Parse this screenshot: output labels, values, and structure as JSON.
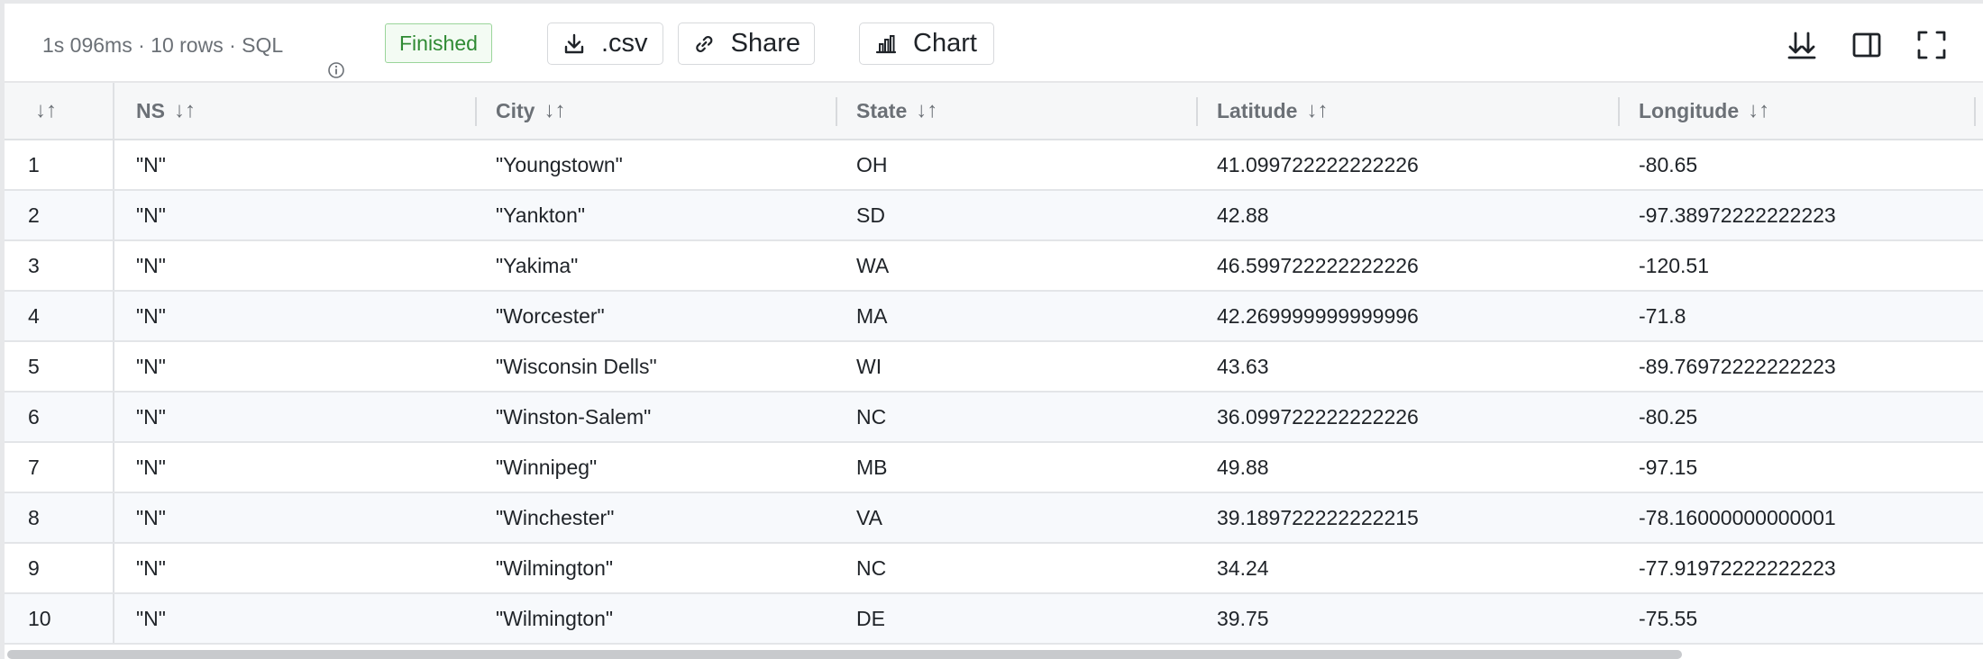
{
  "toolbar": {
    "duration": "1s 096ms",
    "sep": " · ",
    "rows": "10 rows",
    "lang": "SQL",
    "status": "Finished",
    "csv_label": ".csv",
    "share_label": "Share",
    "chart_label": "Chart"
  },
  "table": {
    "columns": [
      "NS",
      "City",
      "State",
      "Latitude",
      "Longitude"
    ],
    "rows": [
      {
        "idx": "1",
        "ns": "\"N\"",
        "city": "\"Youngstown\"",
        "state": "OH",
        "lat": "41.099722222222226",
        "lon": "-80.65"
      },
      {
        "idx": "2",
        "ns": "\"N\"",
        "city": "\"Yankton\"",
        "state": "SD",
        "lat": "42.88",
        "lon": "-97.38972222222223"
      },
      {
        "idx": "3",
        "ns": "\"N\"",
        "city": "\"Yakima\"",
        "state": "WA",
        "lat": "46.599722222222226",
        "lon": "-120.51"
      },
      {
        "idx": "4",
        "ns": "\"N\"",
        "city": "\"Worcester\"",
        "state": "MA",
        "lat": "42.269999999999996",
        "lon": "-71.8"
      },
      {
        "idx": "5",
        "ns": "\"N\"",
        "city": "\"Wisconsin Dells\"",
        "state": "WI",
        "lat": "43.63",
        "lon": "-89.76972222222223"
      },
      {
        "idx": "6",
        "ns": "\"N\"",
        "city": "\"Winston-Salem\"",
        "state": "NC",
        "lat": "36.099722222222226",
        "lon": "-80.25"
      },
      {
        "idx": "7",
        "ns": "\"N\"",
        "city": "\"Winnipeg\"",
        "state": "MB",
        "lat": "49.88",
        "lon": "-97.15"
      },
      {
        "idx": "8",
        "ns": "\"N\"",
        "city": "\"Winchester\"",
        "state": "VA",
        "lat": "39.189722222222215",
        "lon": "-78.16000000000001"
      },
      {
        "idx": "9",
        "ns": "\"N\"",
        "city": "\"Wilmington\"",
        "state": "NC",
        "lat": "34.24",
        "lon": "-77.91972222222223"
      },
      {
        "idx": "10",
        "ns": "\"N\"",
        "city": "\"Wilmington\"",
        "state": "DE",
        "lat": "39.75",
        "lon": "-75.55"
      }
    ]
  },
  "icons": {
    "info": "info-circle-icon",
    "download": "download-icon",
    "share": "link-icon",
    "chart": "bar-chart-icon",
    "scroll_bottom": "scroll-to-bottom-icon",
    "panel": "side-panel-icon",
    "fullscreen": "fullscreen-icon",
    "sort": "sort-arrows-icon"
  },
  "colors": {
    "status_green": "#2f8a33",
    "status_bg": "#f3fbf3",
    "row_alt": "#f7f9fc",
    "header_bg": "#f6f7f8"
  }
}
